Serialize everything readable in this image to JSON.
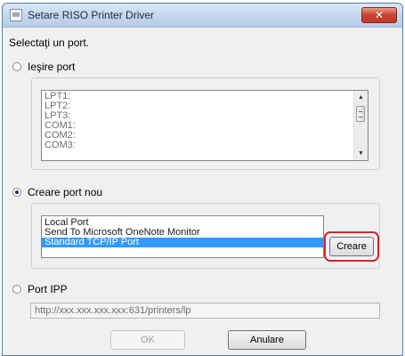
{
  "window": {
    "title": "Setare RISO Printer Driver",
    "close_glyph": "✕"
  },
  "heading": "Selectaţi un port.",
  "existing_port": {
    "label": "Ieşire port",
    "selected": false,
    "items": [
      "LPT1:",
      "LPT2:",
      "LPT3:",
      "COM1:",
      "COM2:",
      "COM3:"
    ],
    "scroll_up_glyph": "▲",
    "scroll_down_glyph": "▼"
  },
  "new_port": {
    "label": "Creare port nou",
    "selected": true,
    "items": [
      "Local Port",
      "Send To Microsoft OneNote Monitor",
      "Standard TCP/IP Port"
    ],
    "selected_item": "Standard TCP/IP Port",
    "create_button": "Creare",
    "highlight_color": "#d9232d"
  },
  "ipp_port": {
    "label": "Port IPP",
    "selected": false,
    "url": "http://xxx.xxx.xxx.xxx:631/printers/lp"
  },
  "footer": {
    "ok_label": "OK",
    "ok_disabled": true,
    "cancel_label": "Anulare"
  }
}
